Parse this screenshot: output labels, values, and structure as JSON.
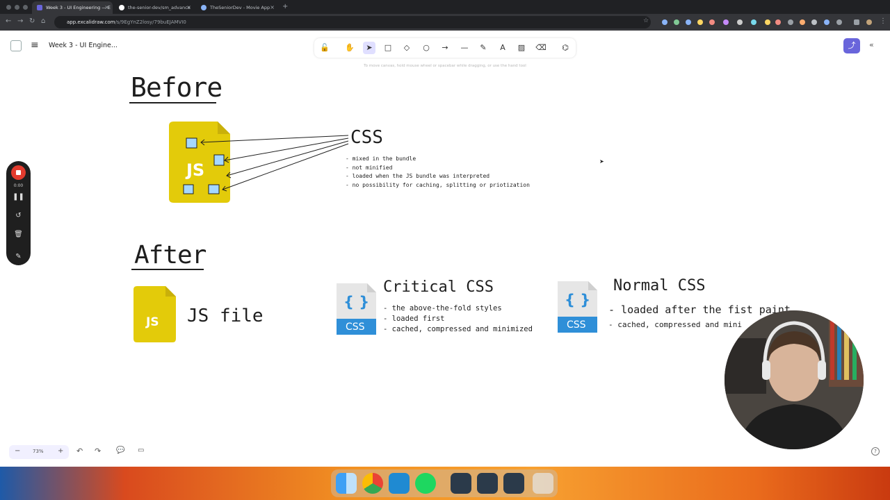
{
  "browser": {
    "tabs": [
      {
        "title": "Week 3 - UI Engineering — E",
        "active": true
      },
      {
        "title": "the-senior-dev/sm_advance",
        "active": false
      },
      {
        "title": "TheSeniorDev - Movie App",
        "active": false
      }
    ],
    "url_host": "app.excalidraw.com",
    "url_path": "/s/9EgYnZ2losy/79buEJAMVI0"
  },
  "app": {
    "doc_name": "Week 3 - UI Engine...",
    "canvas_hint": "To move canvas, hold mouse wheel or spacebar while dragging, or use the hand tool",
    "zoom_level": "73%",
    "accent_color": "#6965db"
  },
  "toolbar": {
    "tools": [
      "lock-icon",
      "hand-icon",
      "selection-icon",
      "rectangle-icon",
      "diamond-icon",
      "ellipse-icon",
      "arrow-icon",
      "line-icon",
      "pencil-icon",
      "text-icon",
      "image-icon",
      "eraser-icon",
      "extra-tools-icon"
    ],
    "selected": "selection-icon"
  },
  "recorder": {
    "time": "0:00"
  },
  "canvas": {
    "before": {
      "title": "Before",
      "js_badge": "JS",
      "css_heading": "CSS",
      "bullets": [
        "- mixed in the bundle",
        "- not minified",
        "- loaded when the JS bundle was interpreted",
        "- no possibility for caching, splitting or priotization"
      ]
    },
    "after": {
      "title": "After",
      "js_badge": "JS",
      "js_label": "JS file",
      "css_braces": "{ }",
      "css_badge": "CSS",
      "critical": {
        "title": "Critical CSS",
        "bullets": [
          "- the above-the-fold styles",
          "- loaded first",
          "- cached, compressed and minimized"
        ]
      },
      "normal": {
        "title": "Normal CSS",
        "bullets": [
          "- loaded after the fist paint.",
          "- cached, compressed and mini"
        ]
      }
    },
    "colors": {
      "js_yellow": "#e3cb0a",
      "css_blue": "#2f8fd8",
      "square_blue": "#a5d8ff"
    }
  }
}
